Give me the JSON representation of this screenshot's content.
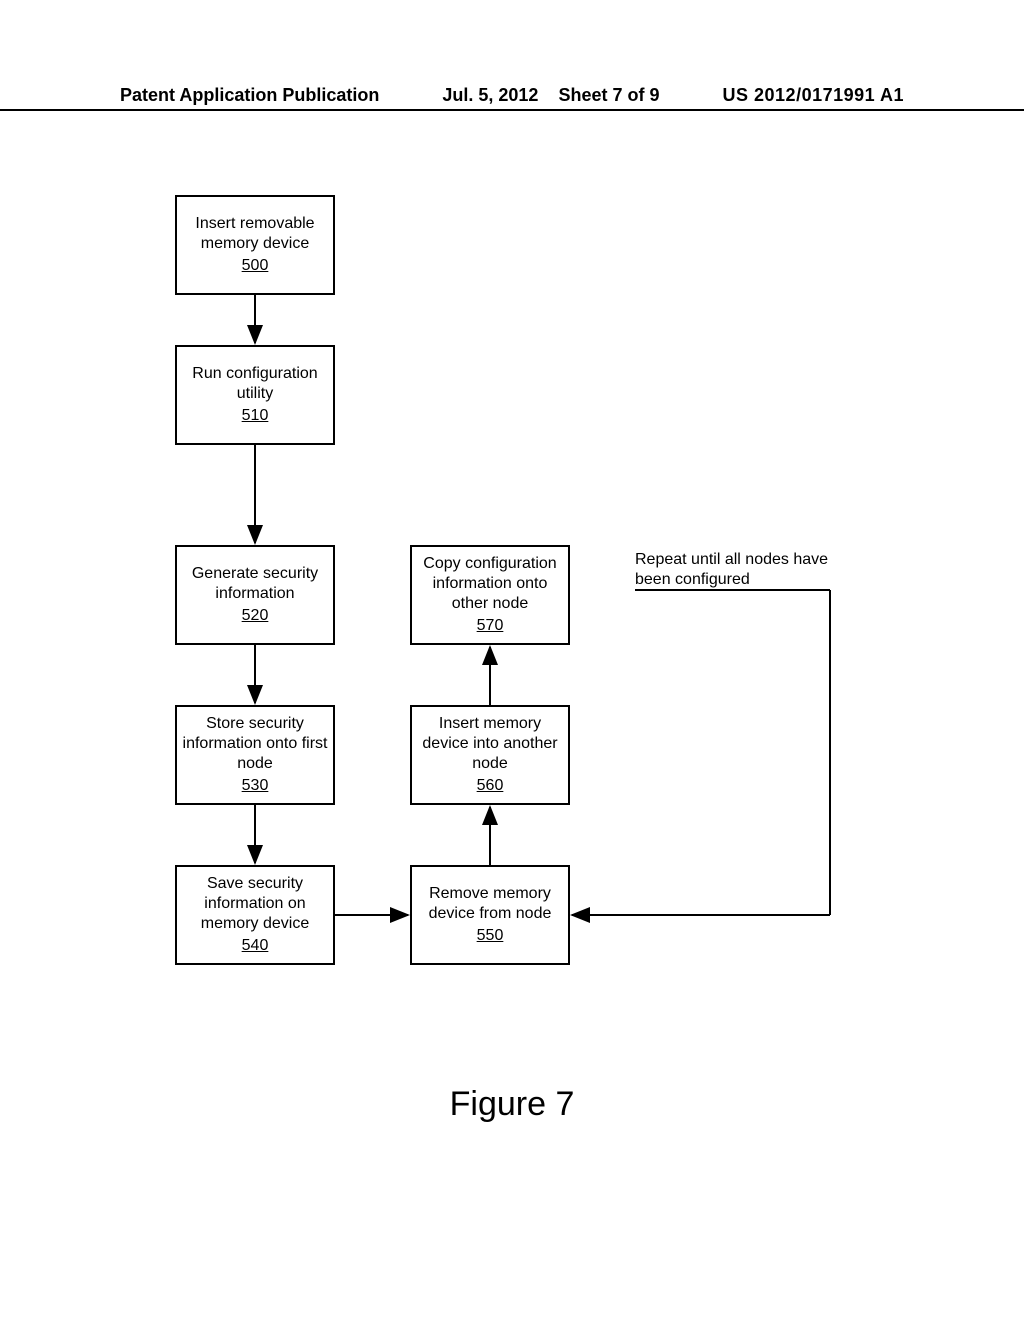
{
  "header": {
    "left": "Patent Application Publication",
    "center_date": "Jul. 5, 2012",
    "center_sheet": "Sheet 7 of 9",
    "right": "US 2012/0171991 A1"
  },
  "chart_data": {
    "type": "flowchart",
    "nodes": [
      {
        "id": "500",
        "label": "Insert removable memory device",
        "ref": "500"
      },
      {
        "id": "510",
        "label": "Run configuration utility",
        "ref": "510"
      },
      {
        "id": "520",
        "label": "Generate security information",
        "ref": "520"
      },
      {
        "id": "530",
        "label": "Store security information onto first node",
        "ref": "530"
      },
      {
        "id": "540",
        "label": "Save security information on memory device",
        "ref": "540"
      },
      {
        "id": "550",
        "label": "Remove memory device from node",
        "ref": "550"
      },
      {
        "id": "560",
        "label": "Insert memory device into another node",
        "ref": "560"
      },
      {
        "id": "570",
        "label": "Copy configuration information onto other node",
        "ref": "570"
      }
    ],
    "edges": [
      {
        "from": "500",
        "to": "510"
      },
      {
        "from": "510",
        "to": "520"
      },
      {
        "from": "520",
        "to": "530"
      },
      {
        "from": "530",
        "to": "540"
      },
      {
        "from": "540",
        "to": "550"
      },
      {
        "from": "550",
        "to": "560"
      },
      {
        "from": "560",
        "to": "570"
      },
      {
        "from": "570",
        "to": "550",
        "note": "loop via side label"
      }
    ],
    "loop_label": "Repeat until all nodes have been configured"
  },
  "figure_caption": "Figure 7"
}
